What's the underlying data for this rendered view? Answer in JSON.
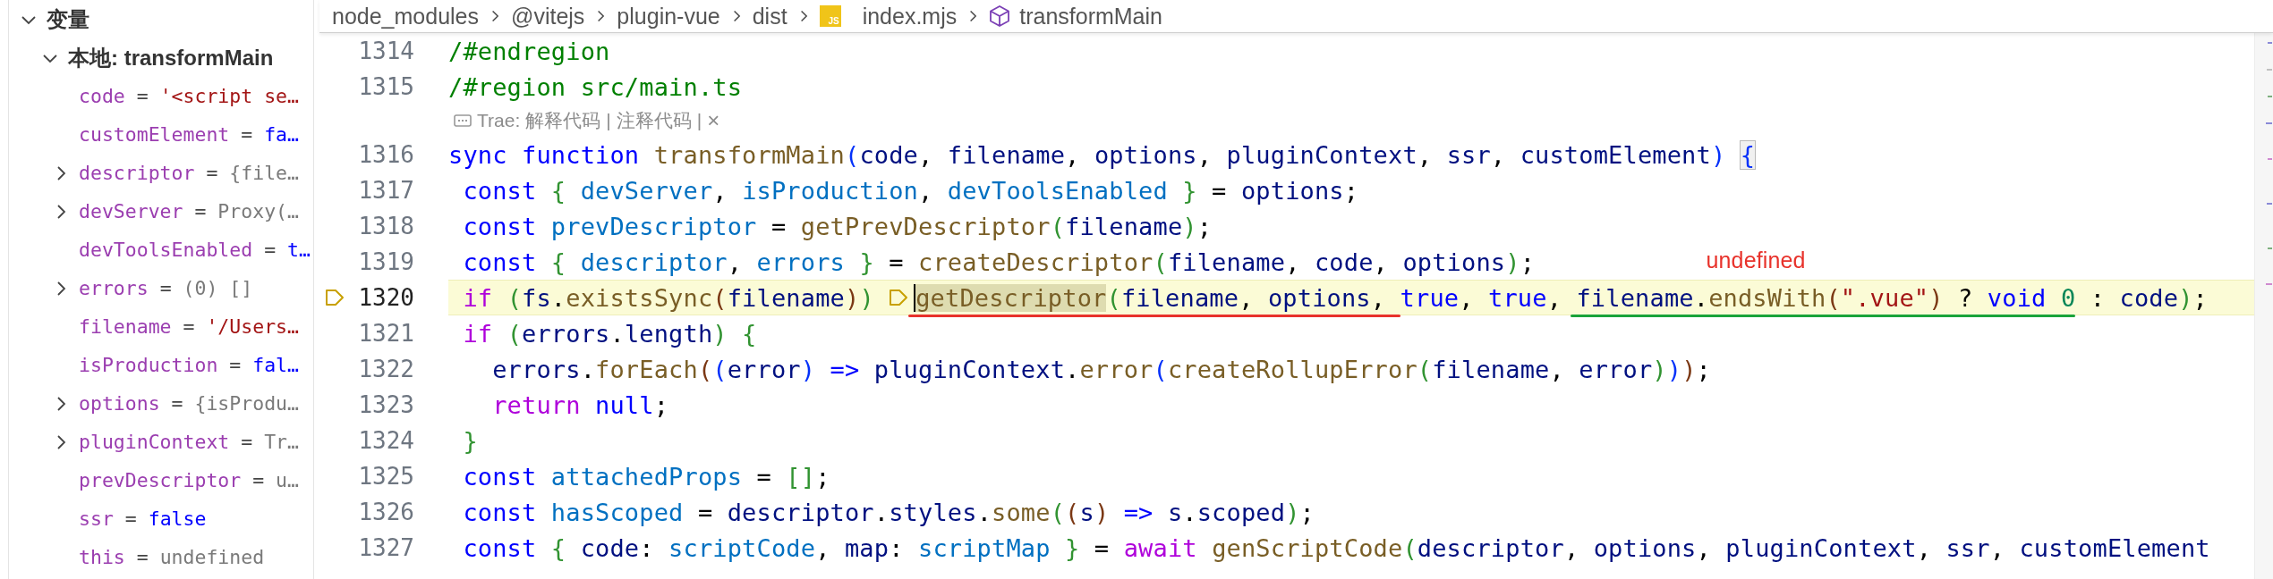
{
  "variables_panel": {
    "title": "变量",
    "expanded": true,
    "children": [
      {
        "title_bold": "本地: transformMain",
        "expanded": true,
        "children": [
          {
            "name": "code",
            "operator": "=",
            "value": "'<script se…",
            "kind": "string",
            "expandable": false
          },
          {
            "name": "customElement",
            "operator": "=",
            "value": "fa…",
            "kind": "boolean",
            "expandable": false
          },
          {
            "name": "descriptor",
            "operator": "=",
            "value": "{file…",
            "kind": "object",
            "expandable": true
          },
          {
            "name": "devServer",
            "operator": "=",
            "value": "Proxy(…",
            "kind": "object",
            "expandable": true
          },
          {
            "name": "devToolsEnabled",
            "operator": "=",
            "value": "t…",
            "kind": "boolean",
            "expandable": false
          },
          {
            "name": "errors",
            "operator": "=",
            "value": "(0) []",
            "kind": "object",
            "expandable": true
          },
          {
            "name": "filename",
            "operator": "=",
            "value": "'/Users…",
            "kind": "string",
            "expandable": false
          },
          {
            "name": "isProduction",
            "operator": "=",
            "value": "fal…",
            "kind": "boolean",
            "expandable": false
          },
          {
            "name": "options",
            "operator": "=",
            "value": "{isProdu…",
            "kind": "object",
            "expandable": true
          },
          {
            "name": "pluginContext",
            "operator": "=",
            "value": "Tr…",
            "kind": "object",
            "expandable": true
          },
          {
            "name": "prevDescriptor",
            "operator": "=",
            "value": "u…",
            "kind": "object",
            "expandable": false
          },
          {
            "name": "ssr",
            "operator": "=",
            "value": "false",
            "kind": "boolean",
            "expandable": false
          },
          {
            "name": "this",
            "operator": "=",
            "value": "undefined",
            "kind": "object",
            "expandable": false
          }
        ]
      }
    ]
  },
  "breadcrumb": [
    {
      "kind": "folder",
      "label": "node_modules"
    },
    {
      "kind": "folder",
      "label": "@vitejs"
    },
    {
      "kind": "folder",
      "label": "plugin-vue"
    },
    {
      "kind": "folder",
      "label": "dist"
    },
    {
      "kind": "file",
      "label": "index.mjs",
      "icon_label": "JS"
    },
    {
      "kind": "symbol",
      "label": "transformMain"
    }
  ],
  "lines": [
    {
      "kind": "code",
      "number": "1314",
      "current": false,
      "breakpoint": false,
      "tokens": [
        {
          "kind": "cmt",
          "text": "/#endregion"
        }
      ]
    },
    {
      "kind": "code",
      "number": "1315",
      "current": false,
      "breakpoint": false,
      "tokens": [
        {
          "kind": "cmt",
          "text": "/#region src/main.ts"
        }
      ]
    },
    {
      "kind": "codelens",
      "items": [
        {
          "kind": "label",
          "text": "Trae:"
        },
        {
          "kind": "link",
          "text": "解释代码"
        },
        {
          "kind": "sep",
          "text": "|"
        },
        {
          "kind": "link",
          "text": "注释代码"
        },
        {
          "kind": "sep",
          "text": "|"
        },
        {
          "kind": "close",
          "text": "×"
        }
      ]
    },
    {
      "kind": "code",
      "number": "1316",
      "current": false,
      "breakpoint": false,
      "tokens": [
        {
          "kind": "kw",
          "text": "sync function "
        },
        {
          "kind": "fn",
          "text": "transformMain"
        },
        {
          "kind": "b1",
          "text": "("
        },
        {
          "kind": "var",
          "text": "code"
        },
        {
          "kind": "p",
          "text": ", "
        },
        {
          "kind": "var",
          "text": "filename"
        },
        {
          "kind": "p",
          "text": ", "
        },
        {
          "kind": "var",
          "text": "options"
        },
        {
          "kind": "p",
          "text": ", "
        },
        {
          "kind": "var",
          "text": "pluginContext"
        },
        {
          "kind": "p",
          "text": ", "
        },
        {
          "kind": "var",
          "text": "ssr"
        },
        {
          "kind": "p",
          "text": ", "
        },
        {
          "kind": "var",
          "text": "customElement"
        },
        {
          "kind": "b1",
          "text": ") "
        },
        {
          "kind": "b1box",
          "text": "{"
        }
      ]
    },
    {
      "kind": "code",
      "number": "1317",
      "current": false,
      "breakpoint": false,
      "tokens": [
        {
          "kind": "kw",
          "text": " const "
        },
        {
          "kind": "b2",
          "text": "{ "
        },
        {
          "kind": "cst",
          "text": "devServer"
        },
        {
          "kind": "p",
          "text": ", "
        },
        {
          "kind": "cst",
          "text": "isProduction"
        },
        {
          "kind": "p",
          "text": ", "
        },
        {
          "kind": "cst",
          "text": "devToolsEnabled "
        },
        {
          "kind": "b2",
          "text": "}"
        },
        {
          "kind": "p",
          "text": " = "
        },
        {
          "kind": "var",
          "text": "options"
        },
        {
          "kind": "p",
          "text": ";"
        }
      ]
    },
    {
      "kind": "code",
      "number": "1318",
      "current": false,
      "breakpoint": false,
      "tokens": [
        {
          "kind": "kw",
          "text": " const "
        },
        {
          "kind": "cst",
          "text": "prevDescriptor"
        },
        {
          "kind": "p",
          "text": " = "
        },
        {
          "kind": "fn",
          "text": "getPrevDescriptor"
        },
        {
          "kind": "b2",
          "text": "("
        },
        {
          "kind": "var",
          "text": "filename"
        },
        {
          "kind": "b2",
          "text": ")"
        },
        {
          "kind": "p",
          "text": ";"
        }
      ]
    },
    {
      "kind": "code",
      "number": "1319",
      "current": false,
      "breakpoint": false,
      "tokens": [
        {
          "kind": "kw",
          "text": " const "
        },
        {
          "kind": "b2",
          "text": "{ "
        },
        {
          "kind": "cst",
          "text": "descriptor"
        },
        {
          "kind": "p",
          "text": ", "
        },
        {
          "kind": "cst",
          "text": "errors "
        },
        {
          "kind": "b2",
          "text": "}"
        },
        {
          "kind": "p",
          "text": " = "
        },
        {
          "kind": "fn",
          "text": "createDescriptor"
        },
        {
          "kind": "b2",
          "text": "("
        },
        {
          "kind": "var",
          "text": "filename"
        },
        {
          "kind": "p",
          "text": ", "
        },
        {
          "kind": "var",
          "text": "code"
        },
        {
          "kind": "p",
          "text": ", "
        },
        {
          "kind": "var",
          "text": "options"
        },
        {
          "kind": "b2",
          "text": ")"
        },
        {
          "kind": "p",
          "text": ";"
        }
      ]
    },
    {
      "kind": "code",
      "number": "1320",
      "current": true,
      "breakpoint": true,
      "tokens": [
        {
          "kind": "ctl",
          "text": " if "
        },
        {
          "kind": "b2",
          "text": "("
        },
        {
          "kind": "var",
          "text": "fs"
        },
        {
          "kind": "p",
          "text": "."
        },
        {
          "kind": "fn",
          "text": "existsSync"
        },
        {
          "kind": "b3",
          "text": "("
        },
        {
          "kind": "var",
          "text": "filename"
        },
        {
          "kind": "b3",
          "text": ")"
        },
        {
          "kind": "b2",
          "text": ") "
        },
        {
          "kind": "breakpoint"
        },
        {
          "kind": "mark",
          "color": "#e8322b",
          "tokens": [
            {
              "kind": "fnsel",
              "text": "getDescriptor"
            },
            {
              "kind": "b2",
              "text": "("
            },
            {
              "kind": "var",
              "text": "filename"
            },
            {
              "kind": "p",
              "text": ", "
            },
            {
              "kind": "var",
              "text": "options"
            },
            {
              "kind": "p",
              "text": ", "
            }
          ]
        },
        {
          "kind": "kw",
          "text": "true"
        },
        {
          "kind": "p",
          "text": ", "
        },
        {
          "kind": "kw",
          "text": "true"
        },
        {
          "kind": "p",
          "text": ", "
        },
        {
          "kind": "mark",
          "color": "#1aa33a",
          "note": {
            "text": "undefined",
            "color": "#e8322b"
          },
          "tokens": [
            {
              "kind": "var",
              "text": "filename"
            },
            {
              "kind": "p",
              "text": "."
            },
            {
              "kind": "fn",
              "text": "endsWith"
            },
            {
              "kind": "b3",
              "text": "("
            },
            {
              "kind": "str",
              "text": "\".vue\""
            },
            {
              "kind": "b3",
              "text": ")"
            },
            {
              "kind": "p",
              "text": " ? "
            },
            {
              "kind": "kw",
              "text": "void "
            },
            {
              "kind": "num",
              "text": "0"
            }
          ]
        },
        {
          "kind": "p",
          "text": " : "
        },
        {
          "kind": "var",
          "text": "code"
        },
        {
          "kind": "b2",
          "text": ")"
        },
        {
          "kind": "p",
          "text": ";"
        }
      ]
    },
    {
      "kind": "code",
      "number": "1321",
      "current": false,
      "breakpoint": false,
      "tokens": [
        {
          "kind": "ctl",
          "text": " if "
        },
        {
          "kind": "b2",
          "text": "("
        },
        {
          "kind": "var",
          "text": "errors"
        },
        {
          "kind": "p",
          "text": "."
        },
        {
          "kind": "var",
          "text": "length"
        },
        {
          "kind": "b2",
          "text": ") {"
        }
      ]
    },
    {
      "kind": "code",
      "number": "1322",
      "current": false,
      "breakpoint": false,
      "tokens": [
        {
          "kind": "var",
          "text": "   errors"
        },
        {
          "kind": "p",
          "text": "."
        },
        {
          "kind": "fn",
          "text": "forEach"
        },
        {
          "kind": "b3",
          "text": "("
        },
        {
          "kind": "b1",
          "text": "("
        },
        {
          "kind": "var",
          "text": "error"
        },
        {
          "kind": "b1",
          "text": ") "
        },
        {
          "kind": "kw",
          "text": "=> "
        },
        {
          "kind": "var",
          "text": "pluginContext"
        },
        {
          "kind": "p",
          "text": "."
        },
        {
          "kind": "fn",
          "text": "error"
        },
        {
          "kind": "b1",
          "text": "("
        },
        {
          "kind": "fn",
          "text": "createRollupError"
        },
        {
          "kind": "b2",
          "text": "("
        },
        {
          "kind": "var",
          "text": "filename"
        },
        {
          "kind": "p",
          "text": ", "
        },
        {
          "kind": "var",
          "text": "error"
        },
        {
          "kind": "b2",
          "text": ")"
        },
        {
          "kind": "b1",
          "text": ")"
        },
        {
          "kind": "b3",
          "text": ")"
        },
        {
          "kind": "p",
          "text": ";"
        }
      ]
    },
    {
      "kind": "code",
      "number": "1323",
      "current": false,
      "breakpoint": false,
      "tokens": [
        {
          "kind": "ctl",
          "text": "   return "
        },
        {
          "kind": "kw",
          "text": "null"
        },
        {
          "kind": "p",
          "text": ";"
        }
      ]
    },
    {
      "kind": "code",
      "number": "1324",
      "current": false,
      "breakpoint": false,
      "tokens": [
        {
          "kind": "b2",
          "text": " }"
        }
      ]
    },
    {
      "kind": "code",
      "number": "1325",
      "current": false,
      "breakpoint": false,
      "tokens": [
        {
          "kind": "kw",
          "text": " const "
        },
        {
          "kind": "cst",
          "text": "attachedProps"
        },
        {
          "kind": "p",
          "text": " = "
        },
        {
          "kind": "b2",
          "text": "[]"
        },
        {
          "kind": "p",
          "text": ";"
        }
      ]
    },
    {
      "kind": "code",
      "number": "1326",
      "current": false,
      "breakpoint": false,
      "tokens": [
        {
          "kind": "kw",
          "text": " const "
        },
        {
          "kind": "cst",
          "text": "hasScoped"
        },
        {
          "kind": "p",
          "text": " = "
        },
        {
          "kind": "var",
          "text": "descriptor"
        },
        {
          "kind": "p",
          "text": "."
        },
        {
          "kind": "var",
          "text": "styles"
        },
        {
          "kind": "p",
          "text": "."
        },
        {
          "kind": "fn",
          "text": "some"
        },
        {
          "kind": "b2",
          "text": "("
        },
        {
          "kind": "b3",
          "text": "("
        },
        {
          "kind": "var",
          "text": "s"
        },
        {
          "kind": "b3",
          "text": ") "
        },
        {
          "kind": "kw",
          "text": "=> "
        },
        {
          "kind": "var",
          "text": "s"
        },
        {
          "kind": "p",
          "text": "."
        },
        {
          "kind": "var",
          "text": "scoped"
        },
        {
          "kind": "b2",
          "text": ")"
        },
        {
          "kind": "p",
          "text": ";"
        }
      ]
    },
    {
      "kind": "code",
      "number": "1327",
      "current": false,
      "breakpoint": false,
      "tokens": [
        {
          "kind": "kw",
          "text": " const "
        },
        {
          "kind": "b2",
          "text": "{ "
        },
        {
          "kind": "var",
          "text": "code"
        },
        {
          "kind": "p",
          "text": ": "
        },
        {
          "kind": "cst",
          "text": "scriptCode"
        },
        {
          "kind": "p",
          "text": ", "
        },
        {
          "kind": "var",
          "text": "map"
        },
        {
          "kind": "p",
          "text": ": "
        },
        {
          "kind": "cst",
          "text": "scriptMap "
        },
        {
          "kind": "b2",
          "text": "}"
        },
        {
          "kind": "p",
          "text": " = "
        },
        {
          "kind": "ctl",
          "text": "await "
        },
        {
          "kind": "fn",
          "text": "genScriptCode"
        },
        {
          "kind": "b2",
          "text": "("
        },
        {
          "kind": "var",
          "text": "descriptor"
        },
        {
          "kind": "p",
          "text": ", "
        },
        {
          "kind": "var",
          "text": "options"
        },
        {
          "kind": "p",
          "text": ", "
        },
        {
          "kind": "var",
          "text": "pluginContext"
        },
        {
          "kind": "p",
          "text": ", "
        },
        {
          "kind": "var",
          "text": "ssr"
        },
        {
          "kind": "p",
          "text": ", "
        },
        {
          "kind": "var",
          "text": "customElement"
        }
      ]
    }
  ]
}
